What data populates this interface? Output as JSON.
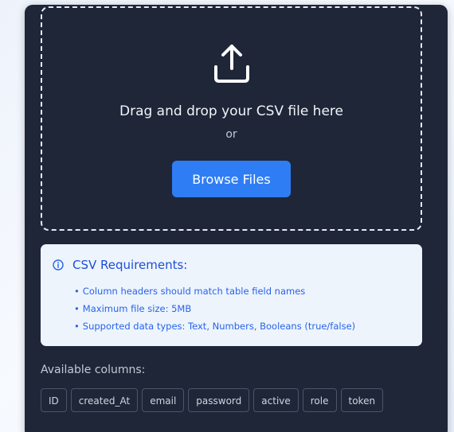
{
  "upload": {
    "icon": "upload-icon",
    "title": "Drag and drop your CSV file here",
    "or_text": "or",
    "browse_label": "Browse Files"
  },
  "requirements": {
    "icon": "info-icon",
    "title": "CSV Requirements:",
    "items": [
      "Column headers should match table field names",
      "Maximum file size: 5MB",
      "Supported data types: Text, Numbers, Booleans (true/false)"
    ]
  },
  "columns": {
    "label": "Available columns:",
    "items": [
      "ID",
      "created_At",
      "email",
      "password",
      "active",
      "role",
      "token"
    ]
  },
  "colors": {
    "panel": "#1e2638",
    "accent": "#2f7df4",
    "info_bg": "#eef4fc",
    "info_text": "#2563eb"
  }
}
